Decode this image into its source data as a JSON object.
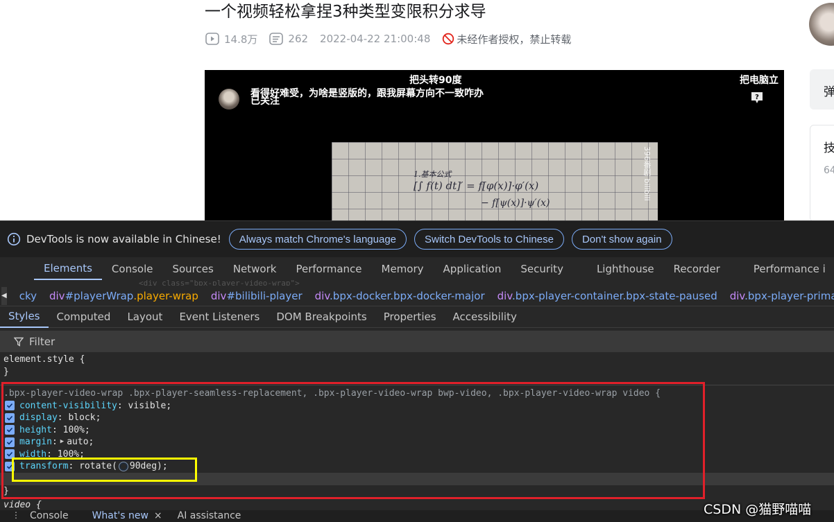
{
  "webpage": {
    "title": "一个视频轻松拿捏3种类型变限积分求导",
    "meta": {
      "views": "14.8万",
      "danmaku_count": "262",
      "datetime": "2022-04-22 21:00:48",
      "notice": "未经作者授权，禁止转载"
    },
    "player": {
      "danmaku": [
        "把头转90度",
        "看得好难受，为啥是竖版的，跟我屏幕方向不一致咋办",
        "把电脑立"
      ],
      "follow_label": "已关注",
      "watermark": "396番剧 bilibili"
    },
    "sidebar": {
      "card1_char": "弹",
      "card2_char": "技",
      "card2_count": "64"
    }
  },
  "devtools": {
    "infobar": {
      "message": "DevTools is now available in Chinese!",
      "buttons": [
        "Always match Chrome's language",
        "Switch DevTools to Chinese",
        "Don't show again"
      ]
    },
    "tabs": [
      "Elements",
      "Console",
      "Sources",
      "Network",
      "Performance",
      "Memory",
      "Application",
      "Security",
      "Lighthouse",
      "Recorder",
      "Performance i"
    ],
    "active_tab": "Elements",
    "ghost_text": "<div class=\"bpx-player-video-wrap\">",
    "breadcrumbs": [
      {
        "el": "",
        "id": "",
        "cls": "cky"
      },
      {
        "el": "div",
        "id": "#playerWrap",
        "cls": ".player-wrap"
      },
      {
        "el": "div",
        "id": "#bilibili-player",
        "cls": ""
      },
      {
        "el": "div",
        "id": "",
        "cls": ".bpx-docker.bpx-docker-major"
      },
      {
        "el": "div",
        "id": "",
        "cls": ".bpx-player-container.bpx-state-paused"
      },
      {
        "el": "div",
        "id": "",
        "cls": ".bpx-player-primary-area"
      }
    ],
    "subtabs": [
      "Styles",
      "Computed",
      "Layout",
      "Event Listeners",
      "DOM Breakpoints",
      "Properties",
      "Accessibility"
    ],
    "filter_label": "Filter",
    "styles": {
      "element_style_open": "element.style {",
      "close_brace": "}",
      "rule_selector": ".bpx-player-video-wrap .bpx-player-seamless-replacement, .bpx-player-video-wrap bwp-video, .bpx-player-video-wrap video {",
      "declarations": [
        {
          "prop": "content-visibility",
          "value": "visible;"
        },
        {
          "prop": "display",
          "value": "block;"
        },
        {
          "prop": "height",
          "value": "100%;"
        },
        {
          "prop": "margin",
          "value": "auto;"
        },
        {
          "prop": "width",
          "value": "100%;"
        },
        {
          "prop": "transform",
          "value_pre": "rotate(",
          "value_post": "90deg);"
        }
      ],
      "next_selector": "video {"
    },
    "drawer_tabs": [
      "Console",
      "What's new",
      "AI assistance"
    ]
  },
  "watermark": "CSDN @猫野喵喵",
  "colors": {
    "devtools_bg": "#282828",
    "accent_blue": "#a8c7fa",
    "highlight_red": "#e0202a",
    "highlight_yellow": "#ffff00"
  }
}
